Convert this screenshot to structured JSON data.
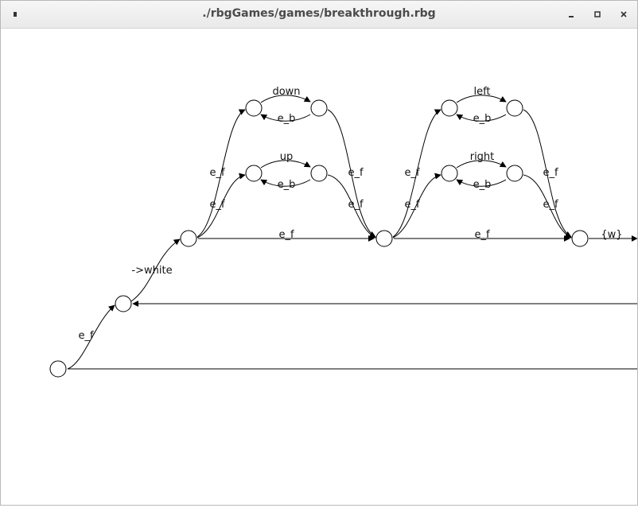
{
  "window": {
    "title": "./rbgGames/games/breakthrough.rbg",
    "menu_icon": "menu-icon",
    "minimize_icon": "minimize-icon",
    "maximize_icon": "maximize-icon",
    "close_icon": "close-icon"
  },
  "graph": {
    "nodes": [
      "n0",
      "n1",
      "n2",
      "n3",
      "n4",
      "n5",
      "n6",
      "n7",
      "n8",
      "n9",
      "n10",
      "n11",
      "n12"
    ],
    "edge_labels": {
      "n0_n1": "e_f",
      "n1_n2": "->white",
      "n2_n3": "e_f",
      "n2_n5": "e_f",
      "n2_n7": "e_f",
      "n3_n4": "down",
      "n4_n3": "e_b",
      "n5_n6": "up",
      "n6_n5": "e_b",
      "n4_n7": "e_f",
      "n6_n7": "e_f",
      "n7_n8": "e_f",
      "n7_n10": "e_f",
      "n7_n12": "e_f",
      "n8_n9": "left",
      "n9_n8": "e_b",
      "n10_n11": "right",
      "n11_n10": "e_b",
      "n9_n12": "e_f",
      "n11_n12": "e_f",
      "n12_out": "{w}"
    }
  }
}
